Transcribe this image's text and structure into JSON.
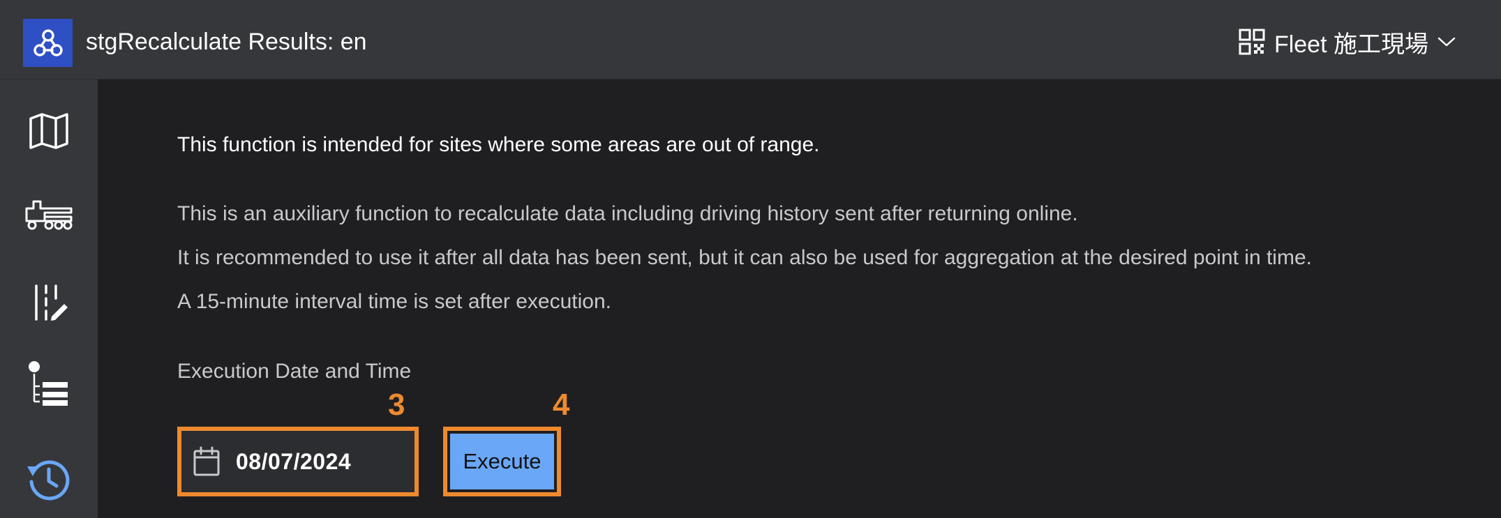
{
  "header": {
    "app_title": "stgRecalculate Results: en",
    "site_name": "Fleet 施工現場"
  },
  "sidebar": {
    "items": [
      {
        "icon": "map-icon"
      },
      {
        "icon": "truck-icon"
      },
      {
        "icon": "layout-edit-icon"
      },
      {
        "icon": "list-icon"
      },
      {
        "icon": "history-icon",
        "active": true
      }
    ]
  },
  "main": {
    "lead": "This function is intended for sites where some areas are out of range.",
    "paragraphs": [
      "This is an auxiliary function to recalculate data including driving history sent after returning online.",
      "It is recommended to use it after all data has been sent, but it can also be used for aggregation at the desired point in time.",
      "A 15-minute interval time is set after execution."
    ],
    "field_label": "Execution Date and Time",
    "date_value": "08/07/2024",
    "execute_label": "Execute",
    "markers": {
      "date": "3",
      "execute": "4"
    }
  },
  "colors": {
    "header_bg": "#36373a",
    "content_bg": "#1f1f22",
    "logo_bg": "#2f4fc4",
    "accent_blue": "#6aa7f6",
    "highlight_orange": "#ee8a2e"
  }
}
